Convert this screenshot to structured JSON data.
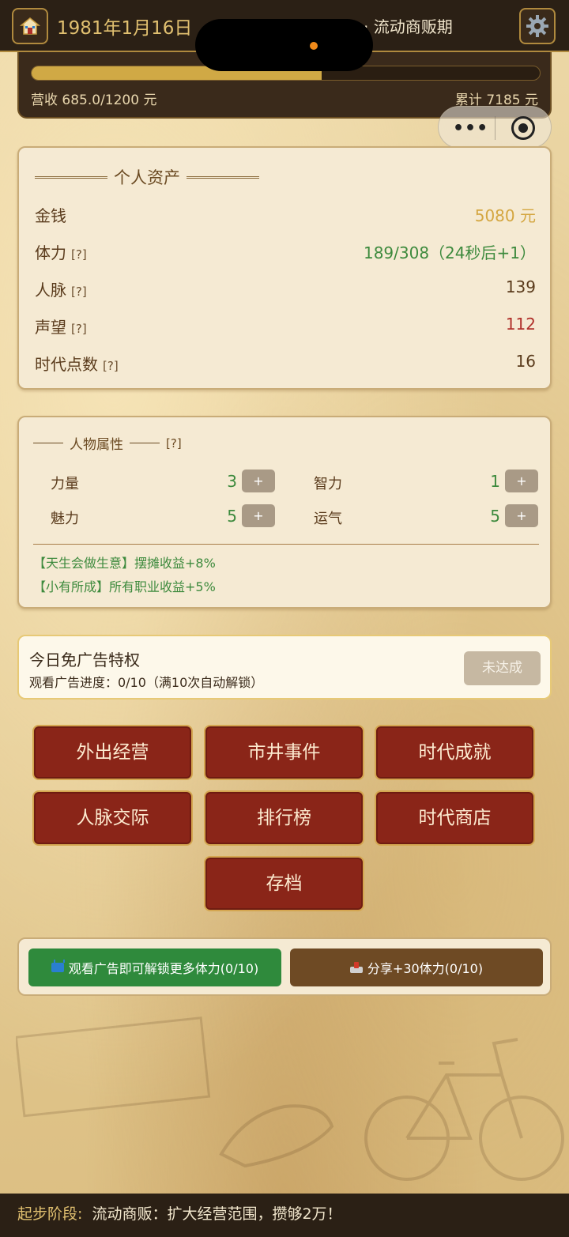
{
  "header": {
    "date": "1981年1月16日",
    "title_visible": "· 流动商贩期",
    "home_icon": "house-icon",
    "settings_icon": "gear-icon"
  },
  "revenue": {
    "progress_fraction": 0.571,
    "label": "营收 685.0/1200 元",
    "total": "累计 7185 元"
  },
  "assets": {
    "title": "个人资产",
    "rows": [
      {
        "label": "金钱",
        "help": "",
        "value": "5080 元",
        "color": "#d4a640"
      },
      {
        "label": "体力",
        "help": "[?]",
        "value": "189/308（24秒后+1）",
        "color": "#3d8a3d"
      },
      {
        "label": "人脉",
        "help": "[?]",
        "value": "139",
        "color": "#5a3b1c"
      },
      {
        "label": "声望",
        "help": "[?]",
        "value": "112",
        "color": "#b0302a"
      },
      {
        "label": "时代点数",
        "help": "[?]",
        "value": "16",
        "color": "#5a3b1c"
      }
    ]
  },
  "attributes": {
    "title": "人物属性",
    "help": "[?]",
    "items": [
      {
        "label": "力量",
        "value": "3",
        "plus": "+"
      },
      {
        "label": "智力",
        "value": "1",
        "plus": "+"
      },
      {
        "label": "魅力",
        "value": "5",
        "plus": "+"
      },
      {
        "label": "运气",
        "value": "5",
        "plus": "+"
      }
    ],
    "traits": [
      "【天生会做生意】摆摊收益+8%",
      "【小有所成】所有职业收益+5%"
    ]
  },
  "ad_privilege": {
    "title": "今日免广告特权",
    "progress": "观看广告进度：0/10（满10次自动解锁）",
    "button": "未达成"
  },
  "menu": [
    "外出经营",
    "市井事件",
    "时代成就",
    "人脉交际",
    "排行榜",
    "时代商店",
    "存档"
  ],
  "ad_panel": {
    "watch_ad": "观看广告即可解锁更多体力(0/10)",
    "share": "分享+30体力(0/10)"
  },
  "footer": {
    "stage": "起步阶段:",
    "goal": "流动商贩：扩大经营范围，攒够2万！"
  }
}
